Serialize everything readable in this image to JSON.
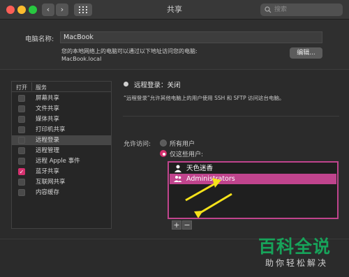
{
  "window": {
    "title": "共享"
  },
  "toolbar": {
    "back_glyph": "‹",
    "forward_glyph": "›",
    "grid_glyph": "⠿",
    "search_placeholder": "搜索"
  },
  "computer": {
    "name_label": "电脑名称:",
    "name_value": "MacBook",
    "hint_line1": "您的本地网络上的电脑可以通过以下地址访问您的电脑:",
    "hint_line2": "MacBook.local",
    "edit_button": "编辑..."
  },
  "services": {
    "header_on": "打开",
    "header_service": "服务",
    "items": [
      {
        "label": "屏幕共享",
        "checked": false
      },
      {
        "label": "文件共享",
        "checked": false
      },
      {
        "label": "媒体共享",
        "checked": false
      },
      {
        "label": "打印机共享",
        "checked": false
      },
      {
        "label": "远程登录",
        "checked": false,
        "selected": true
      },
      {
        "label": "远程管理",
        "checked": false
      },
      {
        "label": "远程 Apple 事件",
        "checked": false
      },
      {
        "label": "蓝牙共享",
        "checked": true
      },
      {
        "label": "互联网共享",
        "checked": false
      },
      {
        "label": "内容缓存",
        "checked": false
      }
    ]
  },
  "remote": {
    "status": "远程登录：关闭",
    "description": "“远程登录”允许其他电脑上的用户使用 SSH 和 SFTP 访问这台电脑。",
    "access_label": "允许访问:",
    "option_all": "所有用户",
    "option_only": "仅这些用户:",
    "users": [
      {
        "name": "天色迷香",
        "selected": false
      },
      {
        "name": "Administrators",
        "selected": true
      }
    ],
    "add_glyph": "+",
    "remove_glyph": "−"
  },
  "watermark": {
    "brand": "百科全说",
    "tagline": "助你轻松解决"
  },
  "colors": {
    "accent": "#d6316f",
    "annotation_arrow": "#f5e21a",
    "watermark_green": "#17a35a"
  }
}
